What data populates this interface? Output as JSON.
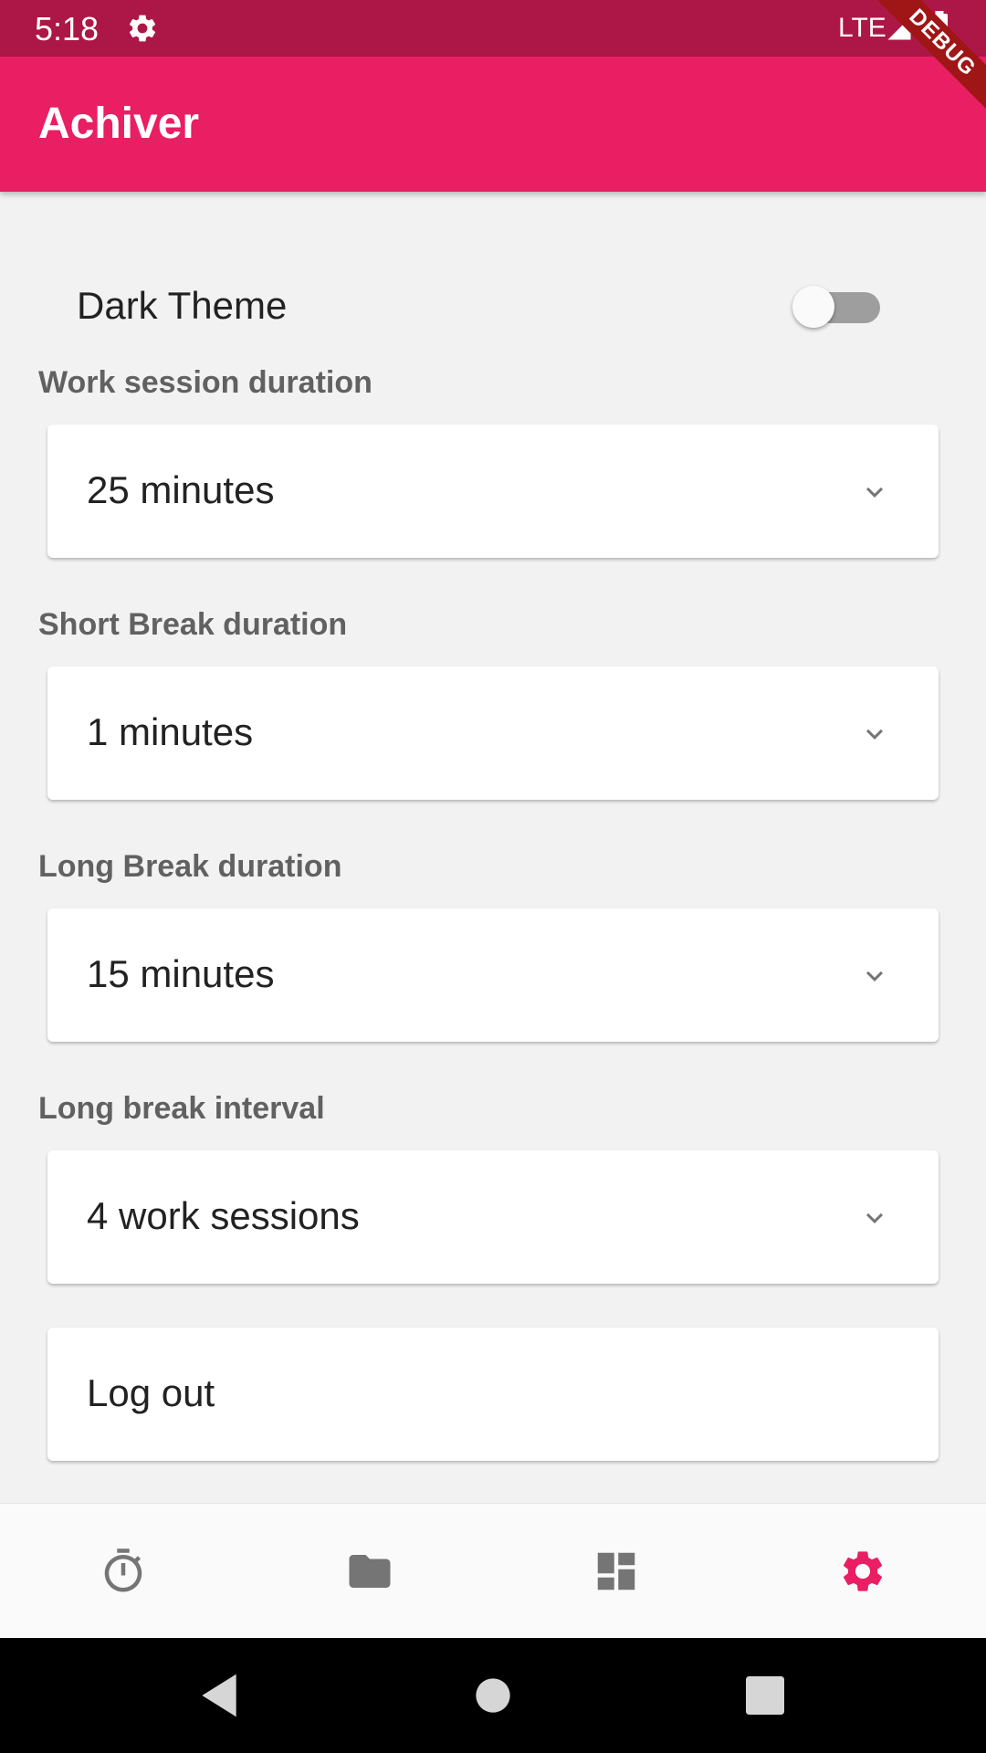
{
  "status_bar": {
    "time": "5:18",
    "network": "LTE"
  },
  "debug_banner": "DEBUG",
  "app_bar": {
    "title": "Achiver"
  },
  "settings": {
    "dark_theme": {
      "label": "Dark Theme",
      "enabled": false
    },
    "work_session": {
      "label": "Work session duration",
      "value": "25 minutes"
    },
    "short_break": {
      "label": "Short Break duration",
      "value": "1 minutes"
    },
    "long_break": {
      "label": "Long Break duration",
      "value": "15 minutes"
    },
    "long_break_interval": {
      "label": "Long break interval",
      "value": "4 work sessions"
    },
    "logout": {
      "label": "Log out"
    }
  },
  "bottom_nav": {
    "items": [
      {
        "icon": "timer-icon",
        "active": false
      },
      {
        "icon": "folder-icon",
        "active": false
      },
      {
        "icon": "dashboard-icon",
        "active": false
      },
      {
        "icon": "settings-icon",
        "active": true
      }
    ],
    "active_color": "#e91e63",
    "inactive_color": "#757575"
  },
  "colors": {
    "primary": "#e91e63",
    "status_bar": "#ad1748",
    "background": "#f2f2f2"
  }
}
